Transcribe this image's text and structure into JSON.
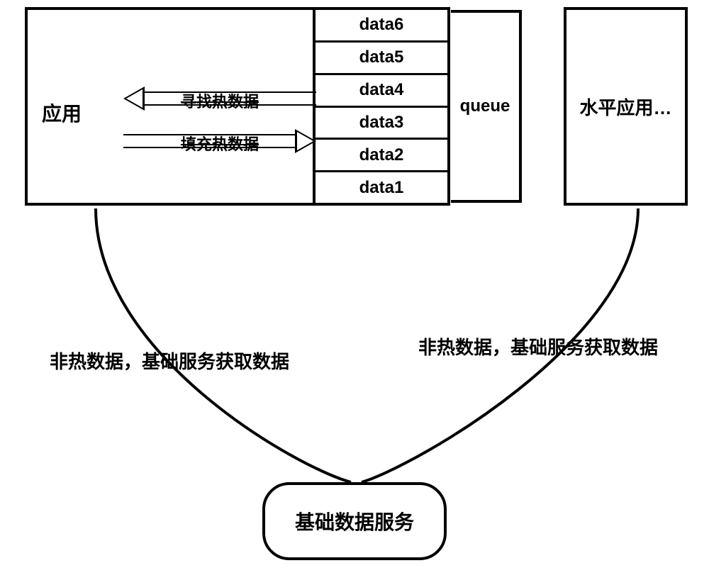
{
  "app": {
    "label": "应用",
    "arrows": {
      "find": "寻找热数据",
      "fill": "填充热数据"
    },
    "queue": {
      "label": "queue",
      "items": [
        "data1",
        "data2",
        "data3",
        "data4",
        "data5",
        "data6"
      ]
    }
  },
  "peer": {
    "label": "水平应用…"
  },
  "edges": {
    "left": "非热数据，基础服务获取数据",
    "right": "非热数据，基础服务获取数据"
  },
  "service": {
    "label": "基础数据服务"
  }
}
